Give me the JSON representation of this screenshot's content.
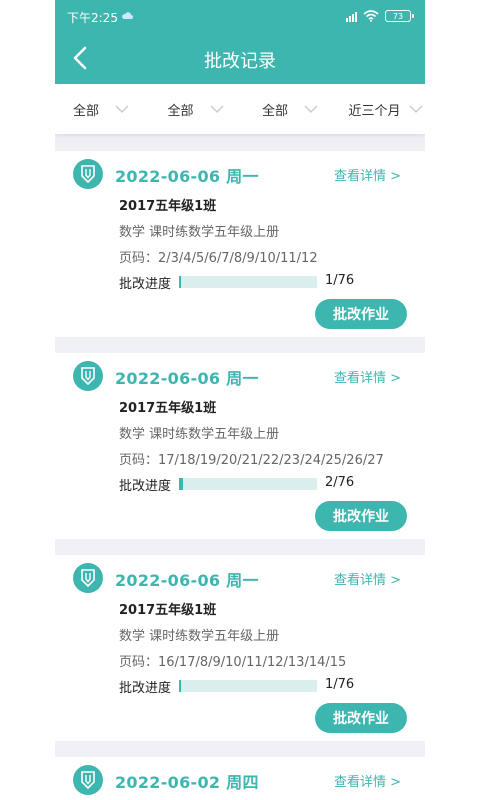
{
  "status": {
    "time": "下午2:25",
    "battery": "73"
  },
  "header": {
    "title": "批改记录"
  },
  "filters": [
    "全部",
    "全部",
    "全部",
    "近三个月"
  ],
  "records": [
    {
      "date": "2022-06-06 周一",
      "detail": "查看详情 >",
      "class": "2017五年级1班",
      "subject": "数学 课时练数学五年级上册",
      "pages": "页码：2/3/4/5/6/7/8/9/10/11/12",
      "progress_label": "批改进度",
      "progress_done": 1,
      "progress_total": 76,
      "progress_text": "1/76",
      "action": "批改作业"
    },
    {
      "date": "2022-06-06 周一",
      "detail": "查看详情 >",
      "class": "2017五年级1班",
      "subject": "数学 课时练数学五年级上册",
      "pages": "页码：17/18/19/20/21/22/23/24/25/26/27",
      "progress_label": "批改进度",
      "progress_done": 2,
      "progress_total": 76,
      "progress_text": "2/76",
      "action": "批改作业"
    },
    {
      "date": "2022-06-06 周一",
      "detail": "查看详情 >",
      "class": "2017五年级1班",
      "subject": "数学 课时练数学五年级上册",
      "pages": "页码：16/17/8/9/10/11/12/13/14/15",
      "progress_label": "批改进度",
      "progress_done": 1,
      "progress_total": 76,
      "progress_text": "1/76",
      "action": "批改作业"
    },
    {
      "date": "2022-06-02 周四",
      "detail": "查看详情 >"
    }
  ],
  "colors": {
    "accent": "#3db6b0",
    "progress_track": "#d9eeed",
    "background": "#eef0f6"
  }
}
